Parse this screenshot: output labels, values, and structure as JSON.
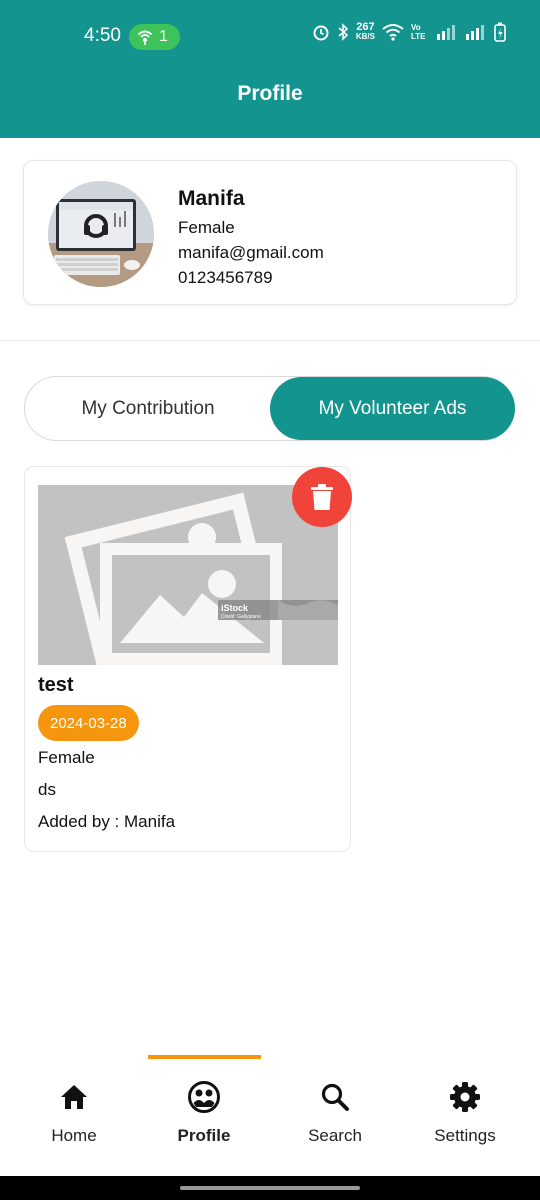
{
  "status_bar": {
    "time": "4:50",
    "hotspot_count": "1",
    "network_speed": "267",
    "network_unit": "KB/S",
    "volte_label": "Vo LTE"
  },
  "app_bar": {
    "title": "Profile"
  },
  "profile": {
    "name": "Manifa",
    "gender": "Female",
    "email": "manifa@gmail.com",
    "phone": "0123456789"
  },
  "tabs": [
    {
      "label": "My Contribution",
      "active": false
    },
    {
      "label": "My Volunteer Ads",
      "active": true
    }
  ],
  "ads": [
    {
      "title": "test",
      "date": "2024-03-28",
      "gender": "Female",
      "description": "ds",
      "added_by": "Added by : Manifa",
      "watermark": "iStock",
      "watermark_credit": "Credit: Gallypiano"
    }
  ],
  "bottom_nav": [
    {
      "label": "Home",
      "icon": "home-icon",
      "active": false
    },
    {
      "label": "Profile",
      "icon": "profile-icon",
      "active": true
    },
    {
      "label": "Search",
      "icon": "search-icon",
      "active": false
    },
    {
      "label": "Settings",
      "icon": "gear-icon",
      "active": false
    }
  ],
  "colors": {
    "primary": "#14948f",
    "accent": "#f6960f",
    "danger": "#f0433a",
    "hotspot": "#3dc35a"
  }
}
